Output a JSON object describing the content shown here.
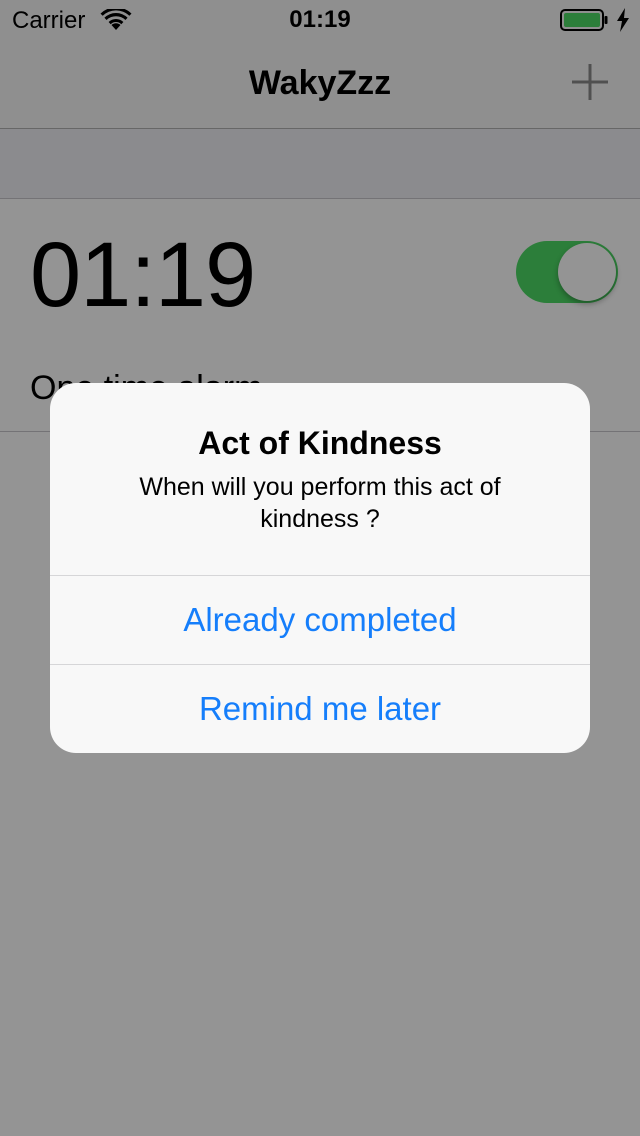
{
  "status_bar": {
    "carrier": "Carrier",
    "time": "01:19",
    "battery_color": "#4cd964"
  },
  "nav": {
    "title": "WakyZzz",
    "add_icon": "plus-icon"
  },
  "alarm": {
    "time": "01:19",
    "label": "One time alarm",
    "enabled": true,
    "toggle_color": "#4cd964"
  },
  "alert": {
    "title": "Act of Kindness",
    "message": "When will you perform this act of kindness ?",
    "buttons": [
      {
        "label": "Already completed"
      },
      {
        "label": "Remind me later"
      }
    ],
    "button_color": "#157efb"
  }
}
